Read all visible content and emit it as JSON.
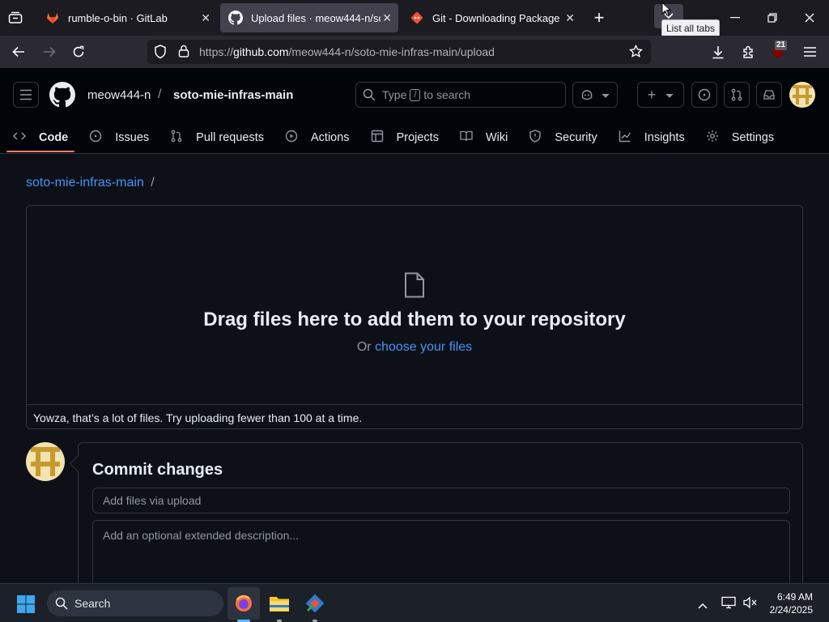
{
  "browser": {
    "tabs": [
      {
        "title": "rumble-o-bin · GitLab",
        "active": false,
        "icon": "gitlab-icon"
      },
      {
        "title": "Upload files · meow444-n/soto-mie-infras-main",
        "active": true,
        "icon": "github-icon"
      },
      {
        "title": "Git - Downloading Package",
        "active": false,
        "icon": "git-icon"
      }
    ],
    "url": "https://github.com/meow444-n/soto-mie-infras-main/upload",
    "url_host": "github.com",
    "url_prefix": "https://",
    "url_path": "/meow444-n/soto-mie-infras-main/upload",
    "tooltip": "List all tabs",
    "extension_badge": "21"
  },
  "github": {
    "owner": "meow444-n",
    "separator": "/",
    "repo": "soto-mie-infras-main",
    "search_prefix": "Type",
    "search_key": "/",
    "search_suffix": "to search",
    "nav": [
      {
        "label": "Code",
        "icon": "code-icon",
        "selected": true
      },
      {
        "label": "Issues",
        "icon": "issue-icon",
        "selected": false
      },
      {
        "label": "Pull requests",
        "icon": "pull-request-icon",
        "selected": false
      },
      {
        "label": "Actions",
        "icon": "play-icon",
        "selected": false
      },
      {
        "label": "Projects",
        "icon": "table-icon",
        "selected": false
      },
      {
        "label": "Wiki",
        "icon": "book-icon",
        "selected": false
      },
      {
        "label": "Security",
        "icon": "shield-icon",
        "selected": false
      },
      {
        "label": "Insights",
        "icon": "graph-icon",
        "selected": false
      },
      {
        "label": "Settings",
        "icon": "gear-icon",
        "selected": false
      }
    ]
  },
  "upload": {
    "breadcrumb_repo": "soto-mie-infras-main",
    "breadcrumb_sep": "/",
    "drop_title": "Drag files here to add them to your repository",
    "drop_or": "Or",
    "choose_link": "choose your files",
    "warning": "Yowza, that’s a lot of files. Try uploading fewer than 100 at a time."
  },
  "commit": {
    "title": "Commit changes",
    "summary_placeholder": "Add files via upload",
    "description_placeholder": "Add an optional extended description..."
  },
  "taskbar": {
    "search_label": "Search",
    "time": "6:49 AM",
    "date": "2/24/2025"
  },
  "colors": {
    "accent_link": "#4493f8",
    "selected_underline": "#f78166",
    "background": "#0d1117"
  }
}
